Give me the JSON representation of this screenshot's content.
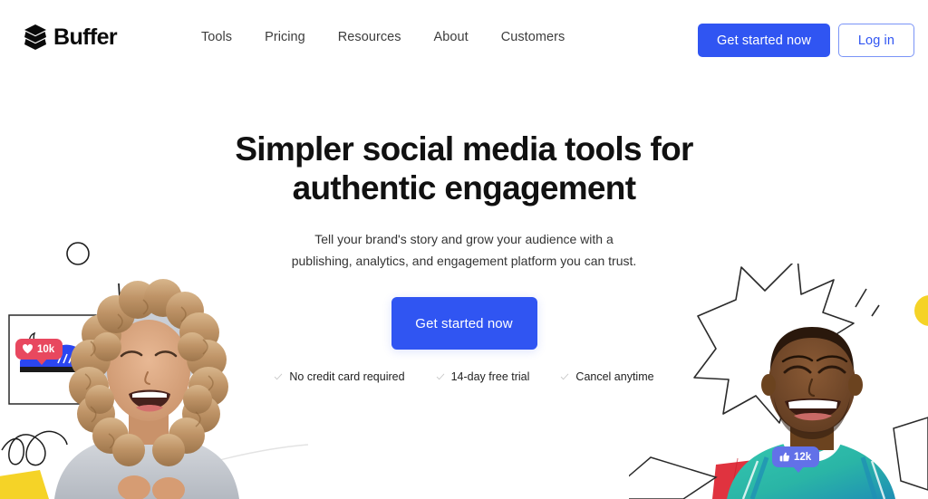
{
  "brand": {
    "name": "Buffer",
    "logo_icon": "stacked-layers-icon"
  },
  "nav": {
    "items": [
      {
        "label": "Tools"
      },
      {
        "label": "Pricing"
      },
      {
        "label": "Resources"
      },
      {
        "label": "About"
      },
      {
        "label": "Customers"
      }
    ]
  },
  "header_actions": {
    "get_started_label": "Get started now",
    "login_label": "Log in"
  },
  "hero": {
    "title_line1": "Simpler social media tools for",
    "title_line2": "authentic engagement",
    "subtitle_line1": "Tell your brand's story and grow your audience with a publishing,",
    "subtitle_line2": "analytics, and engagement platform you can trust.",
    "cta_label": "Get started now",
    "features": [
      {
        "label": "No credit card required",
        "icon": "check-icon"
      },
      {
        "label": "14-day free trial",
        "icon": "check-icon"
      },
      {
        "label": "Cancel anytime",
        "icon": "check-icon"
      }
    ]
  },
  "illustrations": {
    "left": {
      "badge": {
        "count": "10k",
        "icon": "heart-icon",
        "color": "#e8485f"
      },
      "photo_alt": "laughing-woman-curly-hair",
      "doodles": [
        "circle-outline",
        "sketch-lines",
        "shoe-frame-sketch",
        "squiggle",
        "yellow-shape"
      ]
    },
    "right": {
      "badge": {
        "count": "12k",
        "icon": "thumbs-up-icon",
        "color": "#6271e8"
      },
      "photo_alt": "laughing-man-teal-shirt",
      "doodles": [
        "burst-outline",
        "yellow-circle",
        "red-shape",
        "angular-outline"
      ]
    }
  },
  "colors": {
    "accent_blue": "#3055f2",
    "heart_red": "#e8485f",
    "thumb_purple": "#6271e8",
    "text_dark": "#111111",
    "background": "#ffffff"
  }
}
